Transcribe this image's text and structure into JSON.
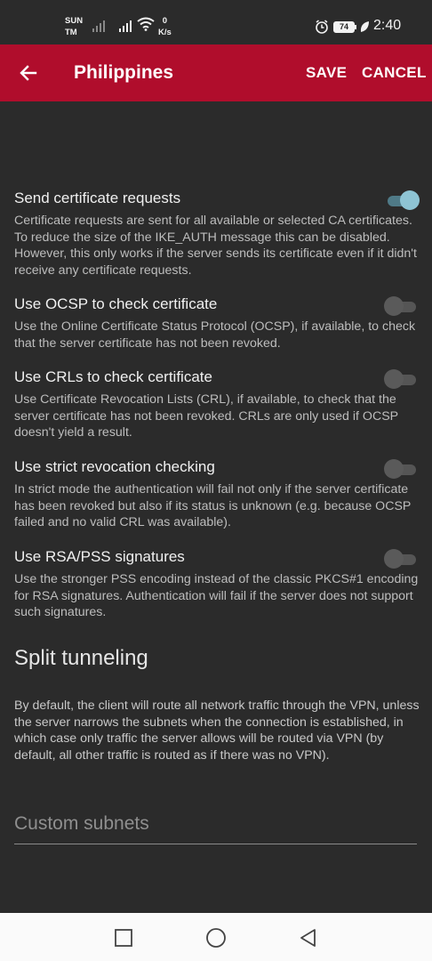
{
  "status_bar": {
    "carrier_line1": "SUN",
    "carrier_line2": "TM",
    "speed_value": "0",
    "speed_unit": "K/s",
    "battery": "74",
    "time": "2:40"
  },
  "toolbar": {
    "title": "Philippines",
    "save_label": "SAVE",
    "cancel_label": "CANCEL"
  },
  "preferences": [
    {
      "title": "Send certificate requests",
      "summary": "Certificate requests are sent for all available or selected CA certificates. To reduce the size of the IKE_AUTH message this can be disabled. However, this only works if the server sends its certificate even if it didn't receive any certificate requests.",
      "enabled": true
    },
    {
      "title": "Use OCSP to check certificate",
      "summary": "Use the Online Certificate Status Protocol (OCSP), if available, to check that the server certificate has not been revoked.",
      "enabled": false
    },
    {
      "title": "Use CRLs to check certificate",
      "summary": "Use Certificate Revocation Lists (CRL), if available, to check that the server certificate has not been revoked. CRLs are only used if OCSP doesn't yield a result.",
      "enabled": false
    },
    {
      "title": "Use strict revocation checking",
      "summary": "In strict mode the authentication will fail not only if the server certificate has been revoked but also if its status is unknown (e.g. because OCSP failed and no valid CRL was available).",
      "enabled": false
    },
    {
      "title": "Use RSA/PSS signatures",
      "summary": "Use the stronger PSS encoding instead of the classic PKCS#1 encoding for RSA signatures. Authentication will fail if the server does not support such signatures.",
      "enabled": false
    }
  ],
  "split_tunneling": {
    "header": "Split tunneling",
    "description": "By default, the client will route all network traffic through the VPN, unless the server narrows the subnets when the connection is established, in which case only traffic the server allows will be routed via VPN (by default, all other traffic is routed as if there was no VPN).",
    "subnets_placeholder": "Custom subnets",
    "subnets_value": ""
  },
  "colors": {
    "toolbar": "#b00d2c",
    "background": "#2b2b2b",
    "switch_on_thumb": "#8ec4d4",
    "switch_on_track": "#4f7a87"
  },
  "icons": {
    "back": "arrow-left-icon",
    "recents": "square-icon",
    "home": "circle-icon",
    "back_nav": "triangle-back-icon"
  }
}
